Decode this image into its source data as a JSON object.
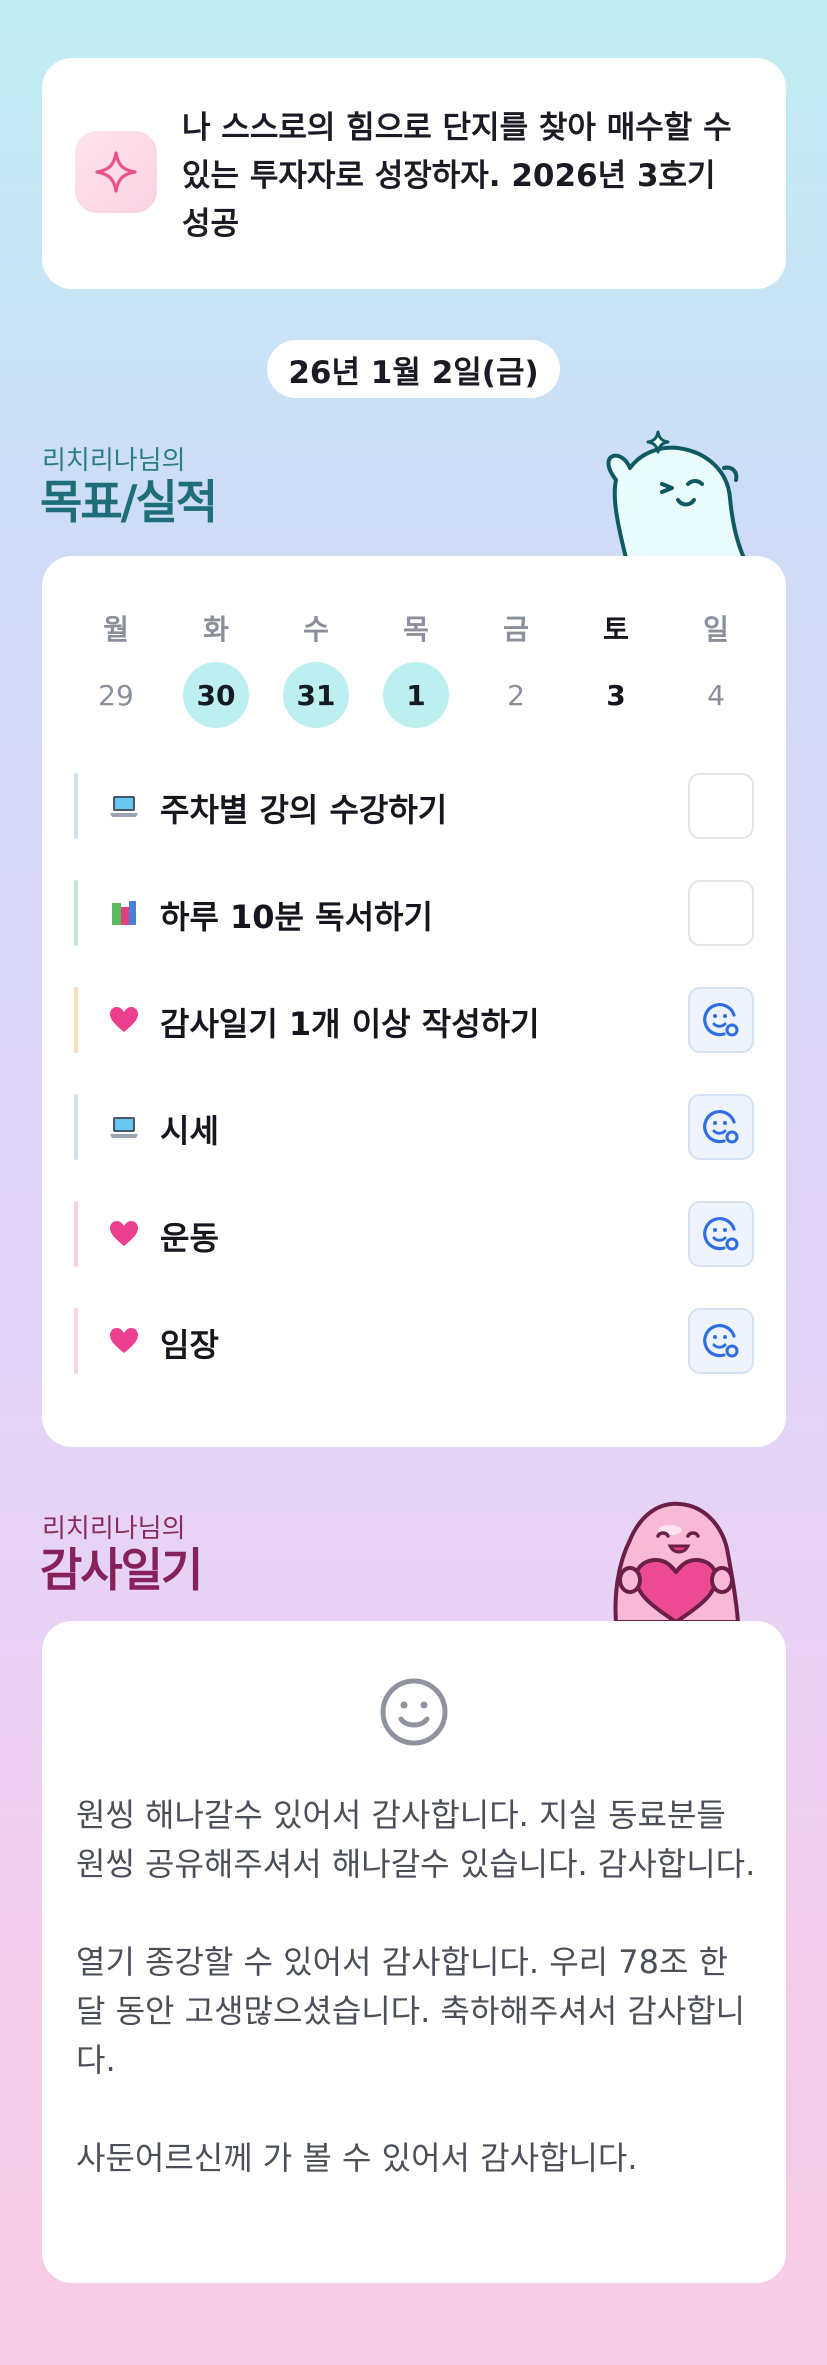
{
  "goal": {
    "text": "나 스스로의 힘으로 단지를 찾아 매수할 수 있는 투자자로 성장하자. 2026년 3호기성공",
    "icon": "sparkle-icon"
  },
  "date_label": "26년 1월 2일(금)",
  "goals_section": {
    "subtitle": "리치리나님의",
    "title": "목표/실적"
  },
  "calendar": {
    "weekdays": [
      "월",
      "화",
      "수",
      "목",
      "금",
      "토",
      "일"
    ],
    "dates": [
      "29",
      "30",
      "31",
      "1",
      "2",
      "3",
      "4"
    ],
    "completed_days": [
      "30",
      "31",
      "1"
    ],
    "today": "3"
  },
  "tasks": [
    {
      "label": "주차별 강의 수강하기",
      "icon": "laptop-icon",
      "done": false,
      "bar_color": "#cfe0ef"
    },
    {
      "label": "하루 10분 독서하기",
      "icon": "books-icon",
      "done": false,
      "bar_color": "#bfe9d3"
    },
    {
      "label": "감사일기 1개 이상 작성하기",
      "icon": "heart-icon",
      "done": true,
      "bar_color": "#f7dfb7"
    },
    {
      "label": "시세",
      "icon": "laptop-icon",
      "done": true,
      "bar_color": "#cfe0ef"
    },
    {
      "label": "운동",
      "icon": "heart-icon",
      "done": true,
      "bar_color": "#f8d1e0"
    },
    {
      "label": "임장",
      "icon": "heart-icon",
      "done": true,
      "bar_color": "#f8d8dc"
    }
  ],
  "gratitude_section": {
    "subtitle": "리치리나님의",
    "title": "감사일기"
  },
  "diary": {
    "icon": "smiley-icon",
    "paragraphs": [
      "원씽 해나갈수 있어서 감사합니다. 지실 동료분들 원씽 공유해주셔서 해나갈수 있습니다. 감사합니다.",
      "열기 종강할 수 있어서 감사합니다. 우리 78조 한달 동안 고생많으셨습니다. 축하해주셔서 감사합니다.",
      "사둔어르신께 가 볼 수 있어서 감사합니다."
    ]
  }
}
